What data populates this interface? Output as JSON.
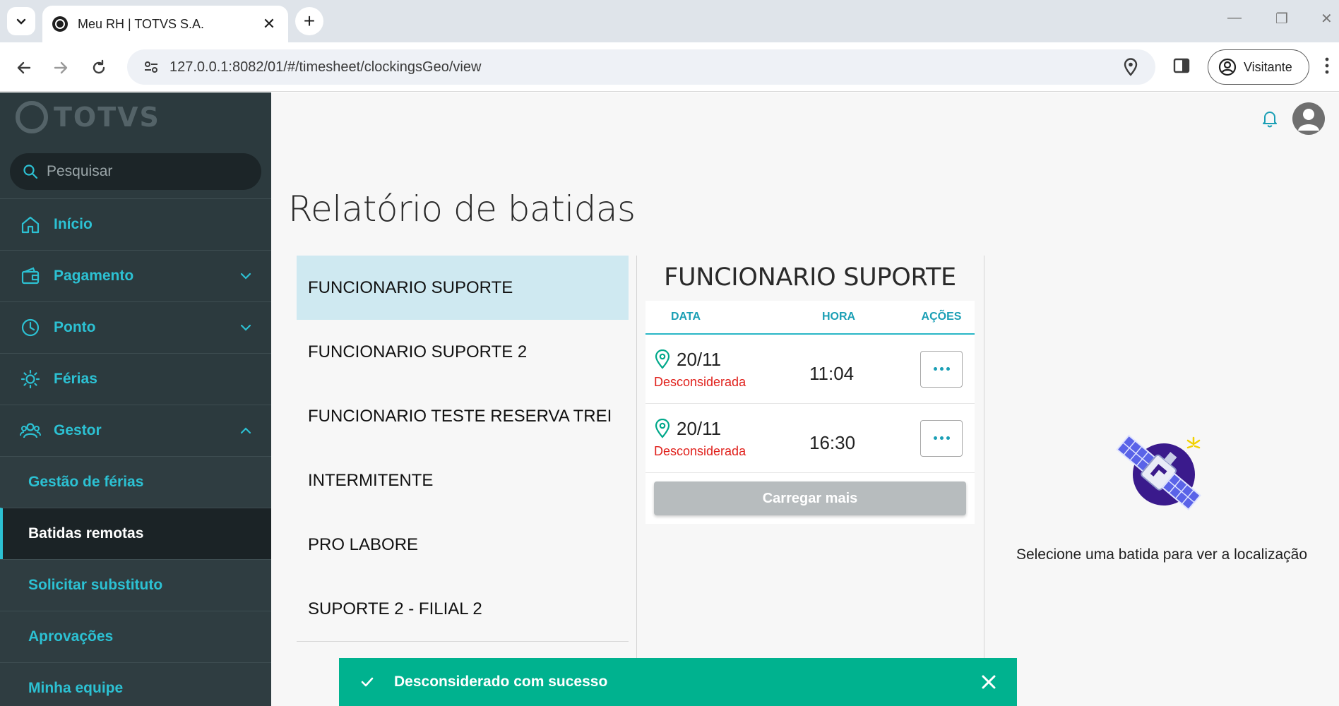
{
  "browser": {
    "tab_title": "Meu RH | TOTVS S.A.",
    "url": "127.0.0.1:8082/01/#/timesheet/clockingsGeo/view",
    "profile_label": "Visitante"
  },
  "sidebar": {
    "brand": "TOTVS",
    "search_placeholder": "Pesquisar",
    "items": [
      {
        "label": "Início",
        "icon": "home-icon"
      },
      {
        "label": "Pagamento",
        "icon": "wallet-icon"
      },
      {
        "label": "Ponto",
        "icon": "clock-icon"
      },
      {
        "label": "Férias",
        "icon": "sun-icon"
      },
      {
        "label": "Gestor",
        "icon": "people-icon"
      }
    ],
    "subitems": [
      {
        "label": "Gestão de férias"
      },
      {
        "label": "Batidas remotas"
      },
      {
        "label": "Solicitar substituto"
      },
      {
        "label": "Aprovações"
      },
      {
        "label": "Minha equipe"
      }
    ],
    "accent_color": "#2cc1d3"
  },
  "main": {
    "title": "Relatório de batidas",
    "employees": [
      "FUNCIONARIO SUPORTE",
      "FUNCIONARIO SUPORTE 2",
      "FUNCIONARIO TESTE RESERVA TREI",
      "INTERMITENTE",
      "PRO LABORE",
      "SUPORTE 2 - FILIAL 2"
    ],
    "detail": {
      "title": "FUNCIONARIO SUPORTE",
      "columns": {
        "data": "DATA",
        "hora": "HORA",
        "acoes": "AÇÕES"
      },
      "rows": [
        {
          "date": "20/11",
          "status": "Desconsiderada",
          "time": "11:04"
        },
        {
          "date": "20/11",
          "status": "Desconsiderada",
          "time": "16:30"
        }
      ],
      "load_more": "Carregar mais"
    },
    "map_hint": "Selecione uma batida para ver a localização"
  },
  "toast": {
    "message": "Desconsiderado com sucesso",
    "color": "#00b28f"
  }
}
